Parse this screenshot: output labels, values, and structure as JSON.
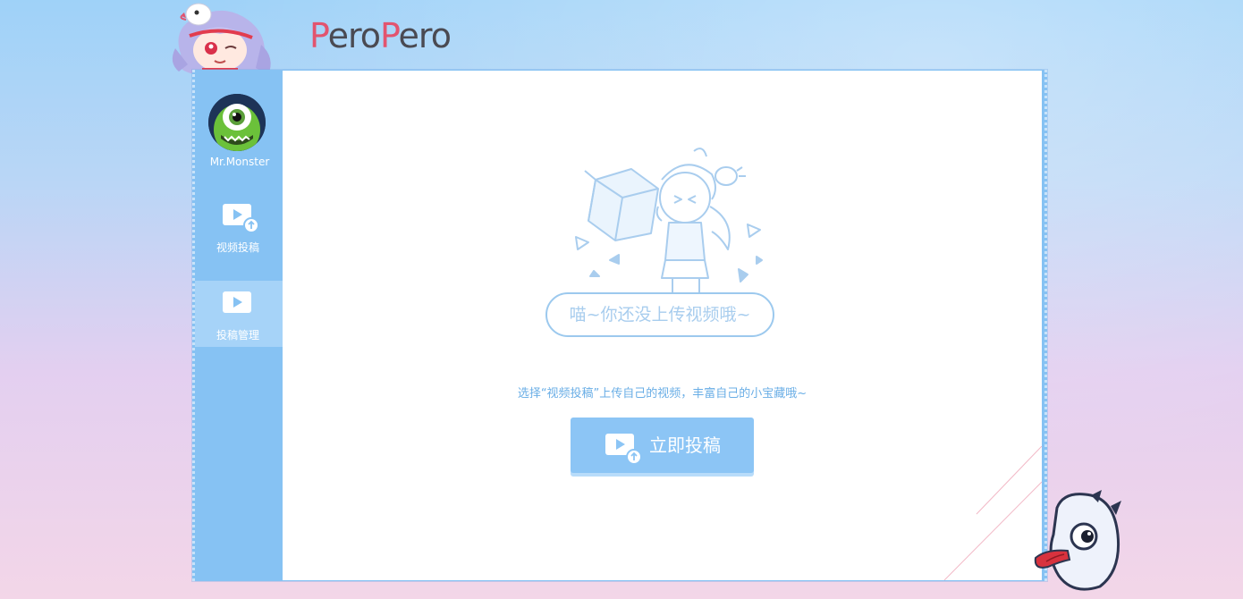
{
  "header": {
    "logo_part1": "P",
    "logo_part2": "ero",
    "logo_part3": "P",
    "logo_part4": "ero"
  },
  "sidebar": {
    "username": "Mr.Monster",
    "items": [
      {
        "label": "视频投稿",
        "icon": "video-upload-icon",
        "active": false
      },
      {
        "label": "投稿管理",
        "icon": "video-manage-icon",
        "active": true
      }
    ]
  },
  "main": {
    "empty_message": "喵~你还没上传视频哦~",
    "hint": "选择“视频投稿”上传自己的视频，丰富自己的小宝藏哦~",
    "upload_button": "立即投稿"
  },
  "colors": {
    "accent": "#8cc5f5",
    "sidebar": "#86c2f3",
    "sidebar_active": "#a6d3f8",
    "logo_pink": "#e2546f",
    "hint_text": "#6aaee6"
  }
}
